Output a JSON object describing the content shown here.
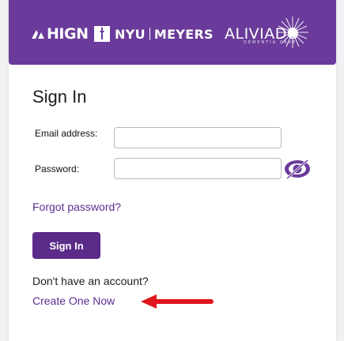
{
  "colors": {
    "brand_purple": "#6a3b9a",
    "button_purple": "#5b2b8a",
    "link_purple": "#5d2e8f",
    "arrow_red": "#e0161c"
  },
  "banner": {
    "logo_hign": "HIGN",
    "logo_nyu_left": "NYU",
    "logo_nyu_right": "MEYERS",
    "logo_aliviado": "ALIVIADO",
    "logo_aliviado_sub": "DEMENTIA CARE"
  },
  "form": {
    "title": "Sign In",
    "email_label": "Email address:",
    "email_value": "",
    "password_label": "Password:",
    "password_value": "",
    "show_password_icon": "eye-icon",
    "forgot_link": "Forgot password?",
    "signin_button": "Sign In",
    "no_account_text": "Don't have an account?",
    "create_link": "Create One Now"
  },
  "annotation": {
    "arrow_icon": "red-arrow-left-icon"
  }
}
